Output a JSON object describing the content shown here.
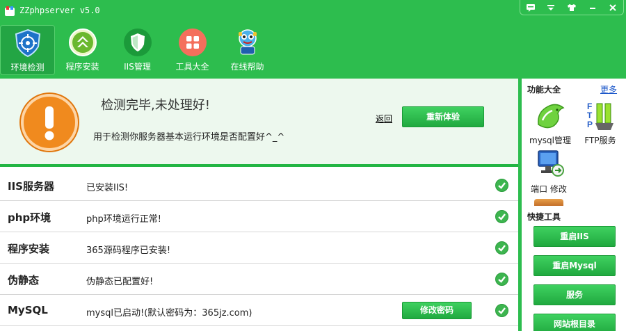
{
  "window": {
    "title": "ZZphpserver v5.0"
  },
  "nav": [
    {
      "label": "环境检测",
      "icon": "shield-target-icon",
      "active": true
    },
    {
      "label": "程序安装",
      "icon": "install-arrows-icon",
      "active": false
    },
    {
      "label": "IIS管理",
      "icon": "green-shield-icon",
      "active": false
    },
    {
      "label": "工具大全",
      "icon": "tools-grid-icon",
      "active": false
    },
    {
      "label": "在线帮助",
      "icon": "help-mascot-icon",
      "active": false
    }
  ],
  "banner": {
    "title": "检测完毕,未处理好!",
    "description": "用于检测你服务器基本运行环境是否配置好^_^",
    "back_link": "返回",
    "retest_button": "重新体验"
  },
  "checks": [
    {
      "label": "IIS服务器",
      "value": "已安装IIS!",
      "status": "ok"
    },
    {
      "label": "php环境",
      "value": "php环境运行正常!",
      "status": "ok"
    },
    {
      "label": "程序安装",
      "value": "365源码程序已安装!",
      "status": "ok"
    },
    {
      "label": "伪静态",
      "value": "伪静态已配置好!",
      "status": "ok"
    },
    {
      "label": "MySQL",
      "value": "mysql已启动!(默认密码为：365jz.com)",
      "status": "ok",
      "action": "修改密码"
    }
  ],
  "side": {
    "features_title": "功能大全",
    "more_link": "更多",
    "tools": [
      {
        "label": "mysql管理",
        "icon": "mysql-dolphin-icon"
      },
      {
        "label": "FTP服务",
        "icon": "ftp-icon"
      },
      {
        "label": "端口 修改",
        "icon": "port-monitor-icon"
      }
    ],
    "quick_title": "快捷工具",
    "quick_buttons": [
      "重启IIS",
      "重启Mysql",
      "服务",
      "网站根目录"
    ]
  },
  "colors": {
    "accent": "#2dbd4e",
    "warning": "#f08a1e",
    "link": "#1a56c9"
  }
}
